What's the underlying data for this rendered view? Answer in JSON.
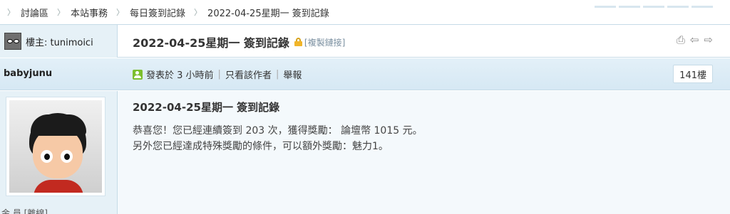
{
  "breadcrumb": [
    "討論區",
    "本站事務",
    "每日簽到記錄",
    "2022-04-25星期一 簽到記錄"
  ],
  "thread": {
    "author_label": "樓主: tunimoici",
    "title": "2022-04-25星期一 簽到記錄",
    "copy_link": "[複製鏈接]"
  },
  "post": {
    "poster": "babyjunu",
    "posted_at": "發表於 3 小時前",
    "only_author": "只看該作者",
    "report": "舉報",
    "floor": "141樓",
    "side_footer": "金 員 [離線]",
    "content_title": "2022-04-25星期一 簽到記錄",
    "lines": [
      "恭喜您！您已經連續簽到 203 次，獲得獎勵： 論壇幣 1015 元。",
      "另外您已經達成特殊獎勵的條件，可以額外獎勵：魅力1。"
    ]
  },
  "colors": {
    "header_bg": "#e3f0f8",
    "border": "#c6dbe7",
    "body_bg": "#f4f9fc",
    "online": "#7cbf2e"
  },
  "icons": [
    "print-icon",
    "prev-thread-icon",
    "next-thread-icon",
    "lock-icon",
    "online-user-icon"
  ]
}
